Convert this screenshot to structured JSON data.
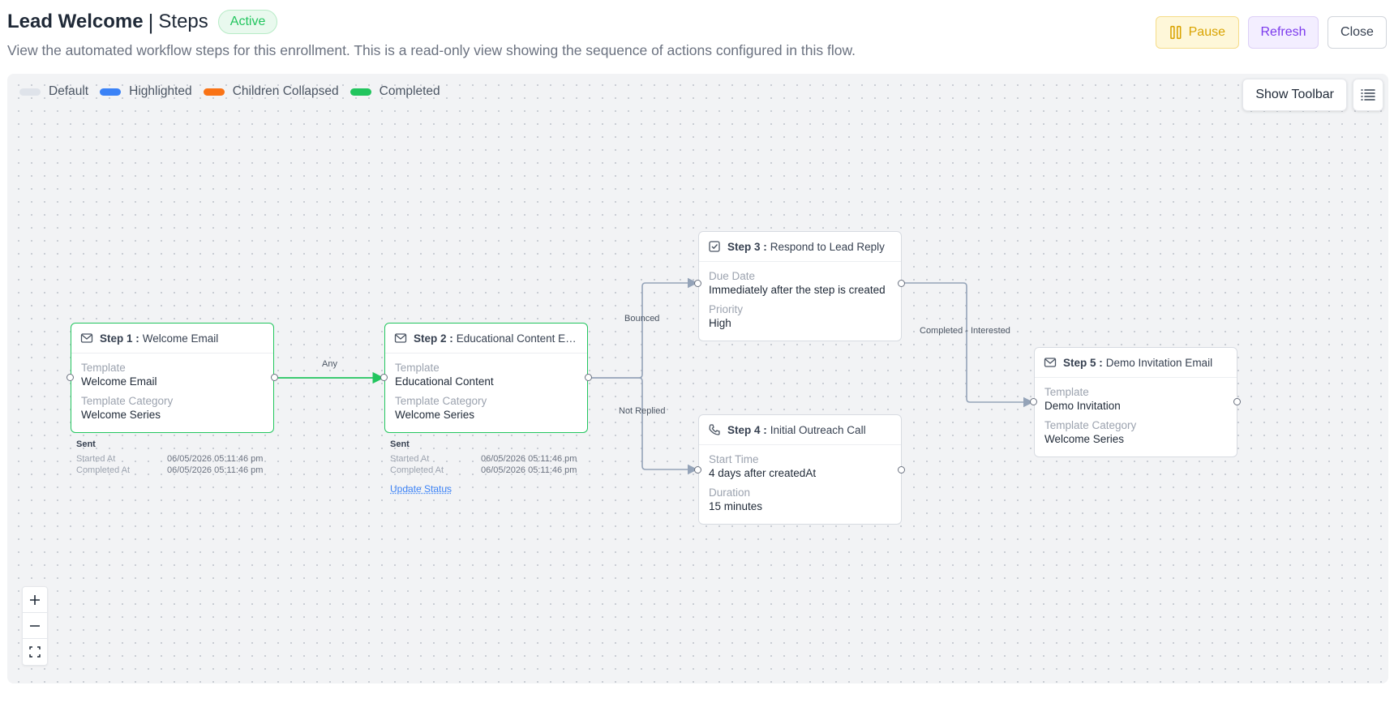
{
  "header": {
    "title": "Lead Welcome",
    "separator": "|",
    "subtitle_title": "Steps",
    "status": "Active",
    "description": "View the automated workflow steps for this enrollment. This is a read-only view showing the sequence of actions configured in this flow."
  },
  "actions": {
    "pause": "Pause",
    "refresh": "Refresh",
    "close": "Close"
  },
  "legend": [
    {
      "label": "Default",
      "color": "#dfe3ea"
    },
    {
      "label": "Highlighted",
      "color": "#3b82f6"
    },
    {
      "label": "Children Collapsed",
      "color": "#f97316"
    },
    {
      "label": "Completed",
      "color": "#22c55e"
    }
  ],
  "toolbar": {
    "show_toolbar": "Show Toolbar"
  },
  "edges": {
    "any": "Any",
    "bounced": "Bounced",
    "not_replied": "Not Replied",
    "completed_interested": "Completed - Interested"
  },
  "steps": [
    {
      "num": "Step 1 :",
      "name": "Welcome Email",
      "icon": "mail-icon",
      "fields": [
        {
          "label": "Template",
          "value": "Welcome Email"
        },
        {
          "label": "Template Category",
          "value": "Welcome Series"
        }
      ],
      "meta": {
        "status": "Sent",
        "started_label": "Started At",
        "started": "06/05/2026 05:11:46 pm",
        "completed_label": "Completed At",
        "completed": "06/05/2026 05:11:46 pm"
      }
    },
    {
      "num": "Step 2 :",
      "name": "Educational Content Em...",
      "icon": "mail-icon",
      "fields": [
        {
          "label": "Template",
          "value": "Educational Content"
        },
        {
          "label": "Template Category",
          "value": "Welcome Series"
        }
      ],
      "meta": {
        "status": "Sent",
        "started_label": "Started At",
        "started": "06/05/2026 05:11:46 pm",
        "completed_label": "Completed At",
        "completed": "06/05/2026 05:11:46 pm",
        "link": "Update Status"
      }
    },
    {
      "num": "Step 3 :",
      "name": "Respond to Lead Reply",
      "icon": "task-check-icon",
      "fields": [
        {
          "label": "Due Date",
          "value": "Immediately after the step is created"
        },
        {
          "label": "Priority",
          "value": "High"
        }
      ]
    },
    {
      "num": "Step 4 :",
      "name": "Initial Outreach Call",
      "icon": "phone-icon",
      "fields": [
        {
          "label": "Start Time",
          "value": "4 days after createdAt"
        },
        {
          "label": "Duration",
          "value": "15 minutes"
        }
      ]
    },
    {
      "num": "Step 5 :",
      "name": "Demo Invitation Email",
      "icon": "mail-icon",
      "fields": [
        {
          "label": "Template",
          "value": "Demo Invitation"
        },
        {
          "label": "Template Category",
          "value": "Welcome Series"
        }
      ]
    }
  ]
}
